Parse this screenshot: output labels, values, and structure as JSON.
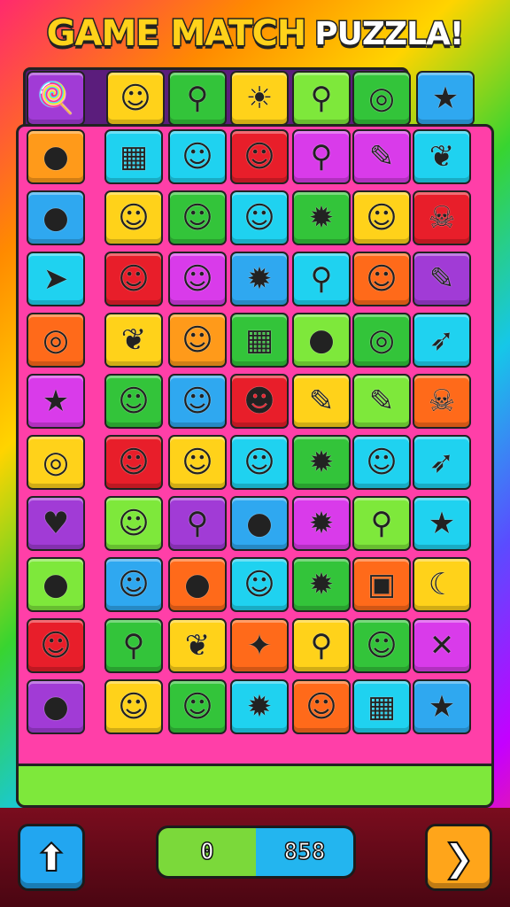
{
  "title": {
    "part1": "GAME MATCH",
    "part2": "PUZZLA!"
  },
  "board": {
    "top_row": [
      {
        "color": "#a13bd6",
        "icon": "candy-apple-icon",
        "glyph": "🍭"
      },
      {
        "color": "#ffd21a",
        "icon": "smiley-blob-icon",
        "glyph": "☺"
      },
      {
        "color": "#33c43a",
        "icon": "pacifier-icon",
        "glyph": "⚲"
      },
      {
        "color": "#ffd21a",
        "icon": "sun-icon",
        "glyph": "☀"
      },
      {
        "color": "#7ee83b",
        "icon": "lollipop-icon",
        "glyph": "⚲"
      },
      {
        "color": "#33c43a",
        "icon": "ring-icon",
        "glyph": "◎"
      },
      {
        "color": "#2fa8f0",
        "icon": "star-fish-icon",
        "glyph": "★"
      }
    ],
    "rows": [
      [
        {
          "color": "#ff9a1a",
          "icon": "pea-pod-icon",
          "glyph": "●"
        },
        {
          "color": "#1fd2f0",
          "icon": "calendar-icon",
          "glyph": "▦"
        },
        {
          "color": "#1fd2f0",
          "icon": "ghost-face-icon",
          "glyph": "☺"
        },
        {
          "color": "#e81e2a",
          "icon": "smiley-blob-icon",
          "glyph": "☺"
        },
        {
          "color": "#d93bea",
          "icon": "lollipop-icon",
          "glyph": "⚲"
        },
        {
          "color": "#d93bea",
          "icon": "marker-icon",
          "glyph": "✎"
        },
        {
          "color": "#1fd2f0",
          "icon": "leaf-icon",
          "glyph": "❦"
        }
      ],
      [
        {
          "color": "#2fa8f0",
          "icon": "bubbles-icon",
          "glyph": "●"
        },
        {
          "color": "#ffd21a",
          "icon": "bear-face-icon",
          "glyph": "☺"
        },
        {
          "color": "#33c43a",
          "icon": "bear-face-icon",
          "glyph": "☺"
        },
        {
          "color": "#1fd2f0",
          "icon": "bear-face-icon",
          "glyph": "☺"
        },
        {
          "color": "#33c43a",
          "icon": "sun-icon",
          "glyph": "✹"
        },
        {
          "color": "#ffd21a",
          "icon": "chick-icon",
          "glyph": "☺"
        },
        {
          "color": "#e81e2a",
          "icon": "squid-icon",
          "glyph": "☠"
        }
      ],
      [
        {
          "color": "#1fd2f0",
          "icon": "rocket-icon",
          "glyph": "➤"
        },
        {
          "color": "#e81e2a",
          "icon": "bear-face-icon",
          "glyph": "☺"
        },
        {
          "color": "#d93bea",
          "icon": "bear-face-icon",
          "glyph": "☺"
        },
        {
          "color": "#2fa8f0",
          "icon": "sun-icon",
          "glyph": "✹"
        },
        {
          "color": "#1fd2f0",
          "icon": "lollipop-icon",
          "glyph": "⚲"
        },
        {
          "color": "#ff6a1a",
          "icon": "chick-icon",
          "glyph": "☺"
        },
        {
          "color": "#a13bd6",
          "icon": "crayon-icon",
          "glyph": "✎"
        }
      ],
      [
        {
          "color": "#ff6a1a",
          "icon": "donut-pair-icon",
          "glyph": "◎"
        },
        {
          "color": "#ffd21a",
          "icon": "popsicle-icon",
          "glyph": "❦"
        },
        {
          "color": "#ff9a1a",
          "icon": "bear-face-icon",
          "glyph": "☺"
        },
        {
          "color": "#33c43a",
          "icon": "calendar-icon",
          "glyph": "▦"
        },
        {
          "color": "#7ee83b",
          "icon": "ladybug-icon",
          "glyph": "●"
        },
        {
          "color": "#33c43a",
          "icon": "ring-icon",
          "glyph": "◎"
        },
        {
          "color": "#1fd2f0",
          "icon": "dart-icon",
          "glyph": "➶"
        }
      ],
      [
        {
          "color": "#d93bea",
          "icon": "star-icon",
          "glyph": "★"
        },
        {
          "color": "#33c43a",
          "icon": "smiley-blob-icon",
          "glyph": "☺"
        },
        {
          "color": "#2fa8f0",
          "icon": "ghost-face-icon",
          "glyph": "☺"
        },
        {
          "color": "#e81e2a",
          "icon": "rock-face-icon",
          "glyph": "☻"
        },
        {
          "color": "#ffd21a",
          "icon": "crayon-icon",
          "glyph": "✎"
        },
        {
          "color": "#7ee83b",
          "icon": "popsicle-icon",
          "glyph": "✎"
        },
        {
          "color": "#ff6a1a",
          "icon": "squid-icon",
          "glyph": "☠"
        }
      ],
      [
        {
          "color": "#ffd21a",
          "icon": "donut-pair-icon",
          "glyph": "◎"
        },
        {
          "color": "#e81e2a",
          "icon": "ghost-face-icon",
          "glyph": "☺"
        },
        {
          "color": "#ffd21a",
          "icon": "bear-face-icon",
          "glyph": "☺"
        },
        {
          "color": "#1fd2f0",
          "icon": "smiley-blob-icon",
          "glyph": "☺"
        },
        {
          "color": "#33c43a",
          "icon": "sun-icon",
          "glyph": "✹"
        },
        {
          "color": "#1fd2f0",
          "icon": "chick-icon",
          "glyph": "☺"
        },
        {
          "color": "#1fd2f0",
          "icon": "dart-icon",
          "glyph": "➶"
        }
      ],
      [
        {
          "color": "#a13bd6",
          "icon": "bird-icon",
          "glyph": "♥"
        },
        {
          "color": "#7ee83b",
          "icon": "frog-icon",
          "glyph": "☺"
        },
        {
          "color": "#a13bd6",
          "icon": "mushroom-icon",
          "glyph": "⚲"
        },
        {
          "color": "#2fa8f0",
          "icon": "bomb-icon",
          "glyph": "●"
        },
        {
          "color": "#d93bea",
          "icon": "sun-icon",
          "glyph": "✹"
        },
        {
          "color": "#7ee83b",
          "icon": "lollipop-icon",
          "glyph": "⚲"
        },
        {
          "color": "#1fd2f0",
          "icon": "star-icon",
          "glyph": "★"
        }
      ],
      [
        {
          "color": "#7ee83b",
          "icon": "bubbles-icon",
          "glyph": "●"
        },
        {
          "color": "#2fa8f0",
          "icon": "bunny-face-icon",
          "glyph": "☺"
        },
        {
          "color": "#ff6a1a",
          "icon": "apple-icon",
          "glyph": "●"
        },
        {
          "color": "#1fd2f0",
          "icon": "smiley-blob-icon",
          "glyph": "☺"
        },
        {
          "color": "#33c43a",
          "icon": "sun-icon",
          "glyph": "✹"
        },
        {
          "color": "#ff6a1a",
          "icon": "card-icon",
          "glyph": "▣"
        },
        {
          "color": "#ffd21a",
          "icon": "banana-icon",
          "glyph": "☾"
        }
      ],
      [
        {
          "color": "#e81e2a",
          "icon": "mouse-face-icon",
          "glyph": "☺"
        },
        {
          "color": "#33c43a",
          "icon": "pin-icon",
          "glyph": "⚲"
        },
        {
          "color": "#ffd21a",
          "icon": "spinning-top-icon",
          "glyph": "❦"
        },
        {
          "color": "#ff6a1a",
          "icon": "pushpin-icon",
          "glyph": "✦"
        },
        {
          "color": "#ffd21a",
          "icon": "lollipop-icon",
          "glyph": "⚲"
        },
        {
          "color": "#33c43a",
          "icon": "chick-icon",
          "glyph": "☺"
        },
        {
          "color": "#d93bea",
          "icon": "crossed-tools-icon",
          "glyph": "✕"
        }
      ],
      [
        {
          "color": "#a13bd6",
          "icon": "pea-pod-icon",
          "glyph": "●"
        },
        {
          "color": "#ffd21a",
          "icon": "bear-face-icon",
          "glyph": "☺"
        },
        {
          "color": "#33c43a",
          "icon": "bear-face-icon",
          "glyph": "☺"
        },
        {
          "color": "#1fd2f0",
          "icon": "sun-icon",
          "glyph": "✹"
        },
        {
          "color": "#ff6a1a",
          "icon": "smiley-blob-icon",
          "glyph": "☺"
        },
        {
          "color": "#1fd2f0",
          "icon": "calendar-icon",
          "glyph": "▦"
        },
        {
          "color": "#2fa8f0",
          "icon": "star-fish-icon",
          "glyph": "★"
        }
      ]
    ]
  },
  "controls": {
    "up_icon": "up-arrow-icon",
    "next_icon": "chevron-right-icon",
    "score_left": "0",
    "score_right": "858"
  }
}
